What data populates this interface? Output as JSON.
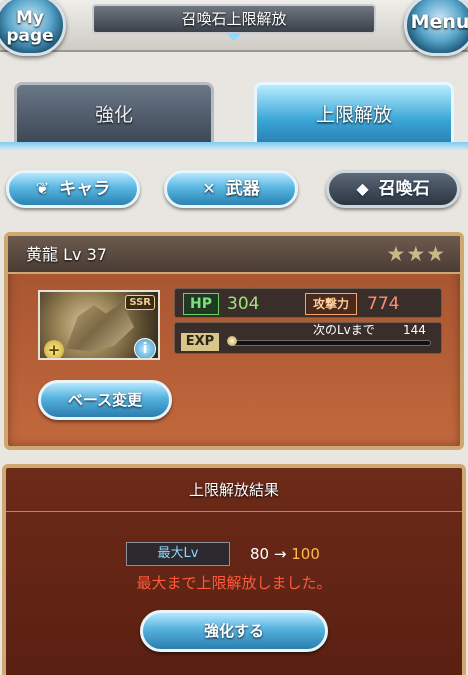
{
  "header": {
    "title": "召喚石上限解放",
    "mypage_label_line1": "My",
    "mypage_label_line2": "page",
    "menu_label": "Menu"
  },
  "tabs": [
    {
      "label": "強化",
      "active": false
    },
    {
      "label": "上限解放",
      "active": true
    }
  ],
  "categories": [
    {
      "label": "キャラ",
      "icon": "chara-icon",
      "active": false
    },
    {
      "label": "武器",
      "icon": "sword-icon",
      "active": false
    },
    {
      "label": "召喚石",
      "icon": "crystal-icon",
      "active": true
    }
  ],
  "summon": {
    "name": "黄龍",
    "level_text": "Lv 37",
    "stars": "★★★",
    "rarity": "SSR",
    "hp_label": "HP",
    "hp_value": "304",
    "atk_label": "攻撃力",
    "atk_value": "774",
    "exp_label": "EXP",
    "exp_next_label": "次のLvまで",
    "exp_next_value": "144",
    "exp_progress": 0,
    "base_change_label": "ベース変更"
  },
  "result": {
    "title": "上限解放結果",
    "max_lv_label": "最大Lv",
    "from": "80",
    "arrow": "→",
    "to": "100",
    "message": "最大まで上限解放しました。",
    "enhance_button": "強化する"
  },
  "colors": {
    "accent": "#3aa5d6",
    "card_bg": "#b25d35",
    "result_bg": "#5a2012",
    "alert_text": "#ff5a3c",
    "hp_text": "#9ee37e",
    "atk_text": "#ff8c73"
  }
}
